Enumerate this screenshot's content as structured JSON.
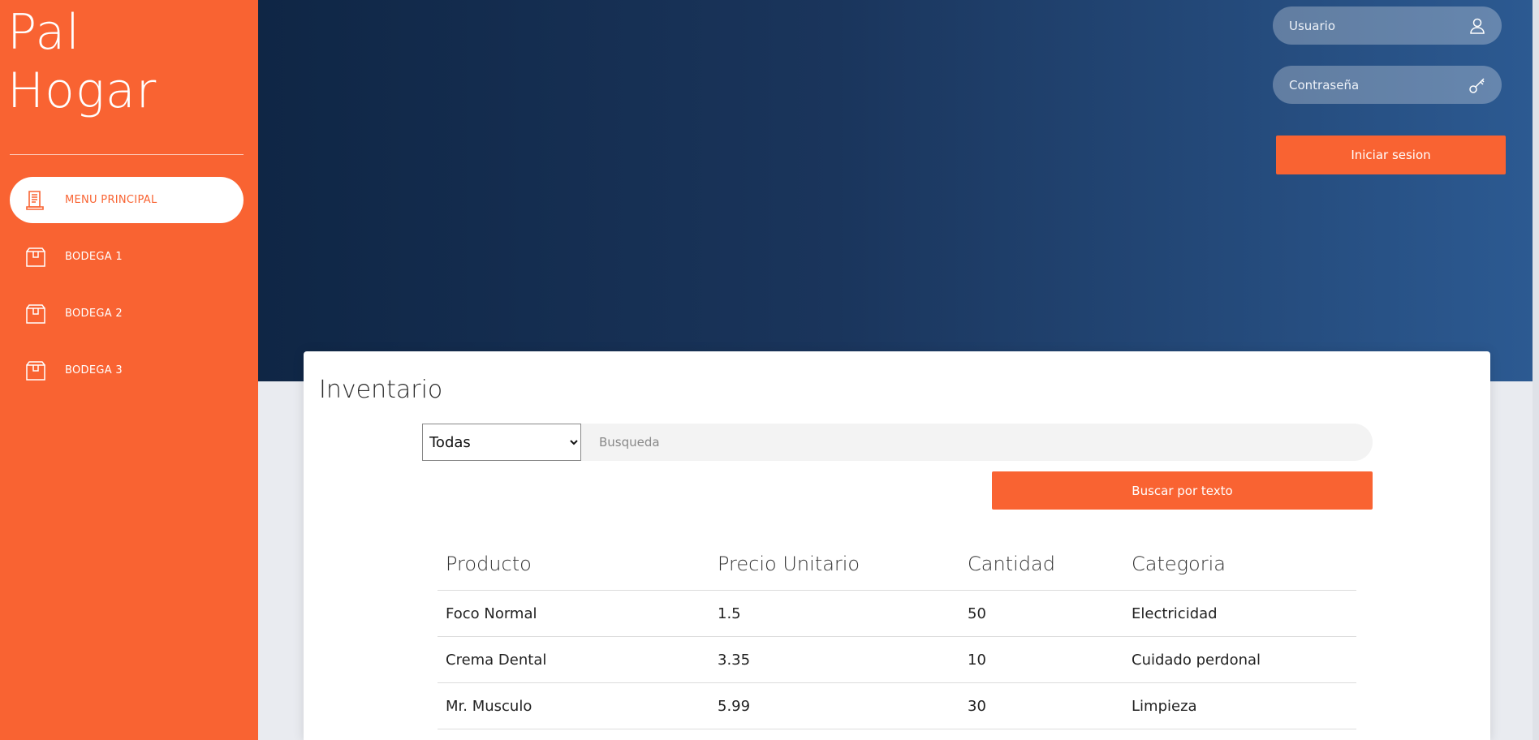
{
  "sidebar": {
    "brand_line1": "Pal",
    "brand_line2": "Hogar",
    "items": [
      {
        "label": "MENU PRINCIPAL",
        "icon": "document-icon",
        "active": true
      },
      {
        "label": "BODEGA 1",
        "icon": "box-icon",
        "active": false
      },
      {
        "label": "BODEGA 2",
        "icon": "box-icon",
        "active": false
      },
      {
        "label": "BODEGA 3",
        "icon": "box-icon",
        "active": false
      }
    ]
  },
  "login": {
    "user_placeholder": "Usuario",
    "password_placeholder": "Contraseña",
    "submit_label": "Iniciar sesion"
  },
  "inventory": {
    "title": "Inventario",
    "filter_selected": "Todas",
    "search_placeholder": "Busqueda",
    "search_button": "Buscar por texto",
    "columns": [
      "Producto",
      "Precio Unitario",
      "Cantidad",
      "Categoria"
    ],
    "rows": [
      [
        "Foco Normal",
        "1.5",
        "50",
        "Electricidad"
      ],
      [
        "Crema Dental",
        "3.35",
        "10",
        "Cuidado perdonal"
      ],
      [
        "Mr. Musculo",
        "5.99",
        "30",
        "Limpieza"
      ]
    ]
  },
  "colors": {
    "accent": "#f96332",
    "header_dark": "#0f2645",
    "header_light": "#2c5a92"
  }
}
